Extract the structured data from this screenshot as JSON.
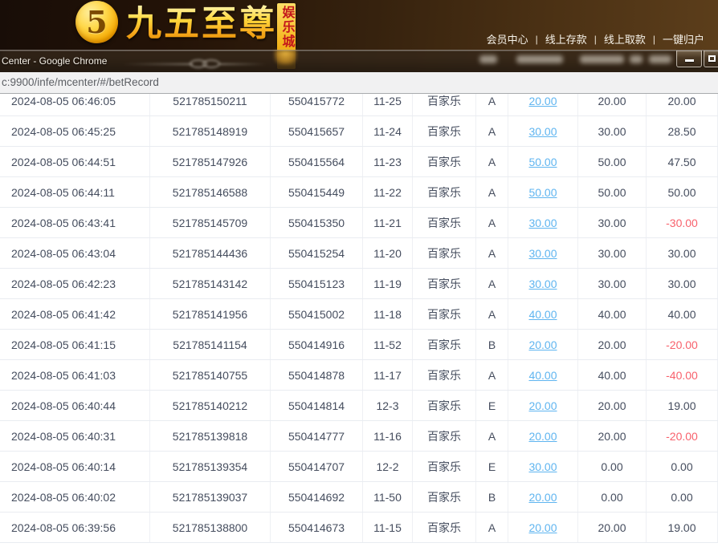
{
  "banner": {
    "logo_glyph": "5",
    "logo_text": "九五至尊",
    "badge_text": "娱乐城",
    "nav_separator": "|",
    "nav_items": [
      "会员中心",
      "线上存款",
      "线上取款",
      "一键归户"
    ]
  },
  "window": {
    "title": "Center - Google Chrome"
  },
  "address_bar": {
    "url": "c:9900/infe/mcenter/#/betRecord"
  },
  "colors": {
    "banner_gold": "#ffc527",
    "badge_red": "#c3161c",
    "link_blue": "#5fb5f0",
    "negative_red": "#f8616c",
    "table_text": "#454d5e"
  },
  "table": {
    "rows": [
      {
        "time": "2024-08-05 06:46:05",
        "bet_id": "521785150211",
        "round_id": "550415772",
        "table_no": "11-25",
        "game": "百家乐",
        "bet_type": "A",
        "bet_amount": "20.00",
        "valid_amount": "20.00",
        "win_loss": "20.00"
      },
      {
        "time": "2024-08-05 06:45:25",
        "bet_id": "521785148919",
        "round_id": "550415657",
        "table_no": "11-24",
        "game": "百家乐",
        "bet_type": "A",
        "bet_amount": "30.00",
        "valid_amount": "30.00",
        "win_loss": "28.50"
      },
      {
        "time": "2024-08-05 06:44:51",
        "bet_id": "521785147926",
        "round_id": "550415564",
        "table_no": "11-23",
        "game": "百家乐",
        "bet_type": "A",
        "bet_amount": "50.00",
        "valid_amount": "50.00",
        "win_loss": "47.50"
      },
      {
        "time": "2024-08-05 06:44:11",
        "bet_id": "521785146588",
        "round_id": "550415449",
        "table_no": "11-22",
        "game": "百家乐",
        "bet_type": "A",
        "bet_amount": "50.00",
        "valid_amount": "50.00",
        "win_loss": "50.00"
      },
      {
        "time": "2024-08-05 06:43:41",
        "bet_id": "521785145709",
        "round_id": "550415350",
        "table_no": "11-21",
        "game": "百家乐",
        "bet_type": "A",
        "bet_amount": "30.00",
        "valid_amount": "30.00",
        "win_loss": "-30.00"
      },
      {
        "time": "2024-08-05 06:43:04",
        "bet_id": "521785144436",
        "round_id": "550415254",
        "table_no": "11-20",
        "game": "百家乐",
        "bet_type": "A",
        "bet_amount": "30.00",
        "valid_amount": "30.00",
        "win_loss": "30.00"
      },
      {
        "time": "2024-08-05 06:42:23",
        "bet_id": "521785143142",
        "round_id": "550415123",
        "table_no": "11-19",
        "game": "百家乐",
        "bet_type": "A",
        "bet_amount": "30.00",
        "valid_amount": "30.00",
        "win_loss": "30.00"
      },
      {
        "time": "2024-08-05 06:41:42",
        "bet_id": "521785141956",
        "round_id": "550415002",
        "table_no": "11-18",
        "game": "百家乐",
        "bet_type": "A",
        "bet_amount": "40.00",
        "valid_amount": "40.00",
        "win_loss": "40.00"
      },
      {
        "time": "2024-08-05 06:41:15",
        "bet_id": "521785141154",
        "round_id": "550414916",
        "table_no": "11-52",
        "game": "百家乐",
        "bet_type": "B",
        "bet_amount": "20.00",
        "valid_amount": "20.00",
        "win_loss": "-20.00"
      },
      {
        "time": "2024-08-05 06:41:03",
        "bet_id": "521785140755",
        "round_id": "550414878",
        "table_no": "11-17",
        "game": "百家乐",
        "bet_type": "A",
        "bet_amount": "40.00",
        "valid_amount": "40.00",
        "win_loss": "-40.00"
      },
      {
        "time": "2024-08-05 06:40:44",
        "bet_id": "521785140212",
        "round_id": "550414814",
        "table_no": "12-3",
        "game": "百家乐",
        "bet_type": "E",
        "bet_amount": "20.00",
        "valid_amount": "20.00",
        "win_loss": "19.00"
      },
      {
        "time": "2024-08-05 06:40:31",
        "bet_id": "521785139818",
        "round_id": "550414777",
        "table_no": "11-16",
        "game": "百家乐",
        "bet_type": "A",
        "bet_amount": "20.00",
        "valid_amount": "20.00",
        "win_loss": "-20.00"
      },
      {
        "time": "2024-08-05 06:40:14",
        "bet_id": "521785139354",
        "round_id": "550414707",
        "table_no": "12-2",
        "game": "百家乐",
        "bet_type": "E",
        "bet_amount": "30.00",
        "valid_amount": "0.00",
        "win_loss": "0.00"
      },
      {
        "time": "2024-08-05 06:40:02",
        "bet_id": "521785139037",
        "round_id": "550414692",
        "table_no": "11-50",
        "game": "百家乐",
        "bet_type": "B",
        "bet_amount": "20.00",
        "valid_amount": "0.00",
        "win_loss": "0.00"
      },
      {
        "time": "2024-08-05 06:39:56",
        "bet_id": "521785138800",
        "round_id": "550414673",
        "table_no": "11-15",
        "game": "百家乐",
        "bet_type": "A",
        "bet_amount": "20.00",
        "valid_amount": "20.00",
        "win_loss": "19.00"
      }
    ]
  }
}
